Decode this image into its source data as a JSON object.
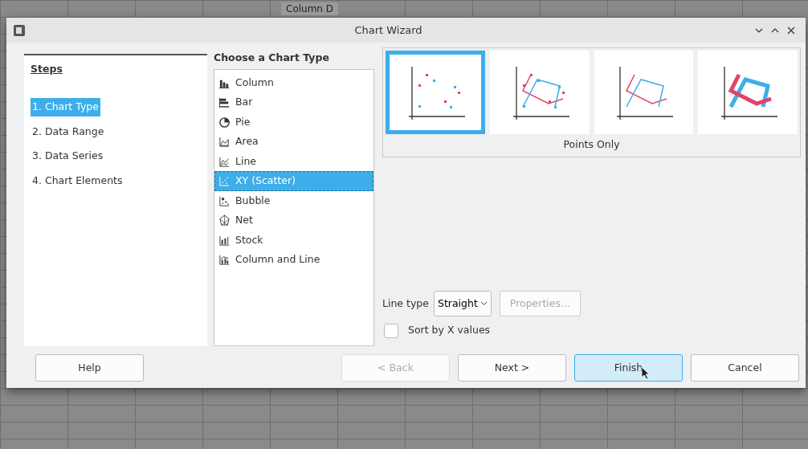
{
  "background": {
    "header_cells": [
      "Column D"
    ]
  },
  "window": {
    "title": "Chart Wizard"
  },
  "steps": {
    "heading": "Steps",
    "items": [
      {
        "label": "1. Chart Type",
        "selected": true
      },
      {
        "label": "2. Data Range",
        "selected": false
      },
      {
        "label": "3. Data Series",
        "selected": false
      },
      {
        "label": "4. Chart Elements",
        "selected": false
      }
    ]
  },
  "chart_types": {
    "heading": "Choose a Chart Type",
    "items": [
      {
        "label": "Column",
        "kind": "column",
        "selected": false
      },
      {
        "label": "Bar",
        "kind": "bar",
        "selected": false
      },
      {
        "label": "Pie",
        "kind": "pie",
        "selected": false
      },
      {
        "label": "Area",
        "kind": "area",
        "selected": false
      },
      {
        "label": "Line",
        "kind": "line",
        "selected": false
      },
      {
        "label": "XY (Scatter)",
        "kind": "scatter",
        "selected": true
      },
      {
        "label": "Bubble",
        "kind": "bubble",
        "selected": false
      },
      {
        "label": "Net",
        "kind": "net",
        "selected": false
      },
      {
        "label": "Stock",
        "kind": "stock",
        "selected": false
      },
      {
        "label": "Column and Line",
        "kind": "columnline",
        "selected": false
      }
    ]
  },
  "variants": {
    "items": [
      {
        "kind": "points",
        "selected": true
      },
      {
        "kind": "points_lines",
        "selected": false
      },
      {
        "kind": "lines",
        "selected": false
      },
      {
        "kind": "lines_3d",
        "selected": false
      }
    ],
    "caption": "Points Only"
  },
  "line_type": {
    "label": "Line type",
    "value": "Straight",
    "properties_button": {
      "label": "Properties...",
      "disabled": true
    }
  },
  "sort_by_x": {
    "label": "Sort by X values",
    "checked": false
  },
  "buttons": [
    {
      "label": "Help",
      "kind": "left",
      "disabled": false,
      "hovered": false
    },
    {
      "label": "< Back",
      "kind": "right",
      "disabled": true,
      "hovered": false
    },
    {
      "label": "Next >",
      "kind": "right",
      "disabled": false,
      "hovered": false
    },
    {
      "label": "Finish",
      "kind": "right",
      "disabled": false,
      "hovered": true
    },
    {
      "label": "Cancel",
      "kind": "right",
      "disabled": false,
      "hovered": false
    }
  ]
}
